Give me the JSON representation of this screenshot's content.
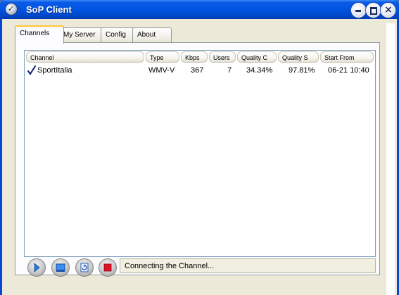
{
  "window": {
    "title": "SoP Client"
  },
  "tabs": [
    {
      "label": "Channels",
      "active": true
    },
    {
      "label": "My Server",
      "active": false
    },
    {
      "label": "Config",
      "active": false
    },
    {
      "label": "About",
      "active": false
    }
  ],
  "table": {
    "columns": [
      "Channel",
      "Type",
      "Kbps",
      "Users",
      "Quality C",
      "Quality S",
      "Start From"
    ],
    "rows": [
      {
        "channel": "SportItalia",
        "type": "WMV-V",
        "kbps": "367",
        "users": "7",
        "quality_c": "34.34%",
        "quality_s": "97.81%",
        "start_from": "06-21 10:40",
        "checked": true
      }
    ]
  },
  "controls": [
    "play-icon",
    "screen-icon",
    "refresh-icon",
    "stop-icon"
  ],
  "status": {
    "text": "Connecting the Channel..."
  },
  "colors": {
    "titlebar": "#0054e0",
    "client_bg": "#ece9d8",
    "tab_highlight": "#ffc83c",
    "stop_red": "#e0102a"
  }
}
